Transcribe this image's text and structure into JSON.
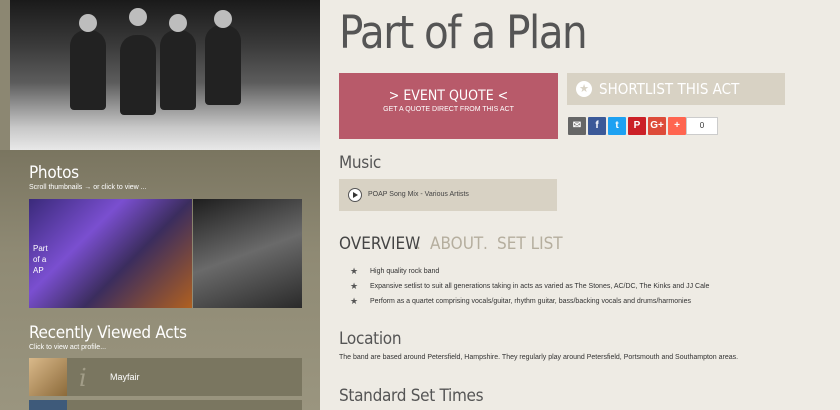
{
  "sidebar": {
    "photos_title": "Photos",
    "photos_subtitle": "Scroll thumbnails → or click to view ...",
    "thumb1_text": "Part\nof a\nAP",
    "recent_title": "Recently Viewed Acts",
    "recent_subtitle": "Click to view act profile...",
    "recent_items": [
      {
        "name": "Mayfair"
      }
    ]
  },
  "main": {
    "title": "Part of a Plan",
    "quote_button": {
      "line1": "> EVENT QUOTE <",
      "line2": "GET A QUOTE DIRECT FROM THIS ACT"
    },
    "shortlist_label": "SHORTLIST THIS ACT",
    "share_count": "0",
    "music_heading": "Music",
    "player_track": "POAP Song Mix - Various Artists",
    "tabs": [
      {
        "label": "OVERVIEW",
        "active": true
      },
      {
        "label": "ABOUT",
        "active": false
      },
      {
        "label": "SET LIST",
        "active": false
      }
    ],
    "tab_separator": ".",
    "overview_points": [
      "High quality rock band",
      "Expansive setlist to suit all generations taking in acts as varied as The Stones, AC/DC, The Kinks and JJ Cale",
      "Perform as a quartet comprising vocals/guitar, rhythm guitar, bass/backing vocals and drums/harmonies"
    ],
    "location_heading": "Location",
    "location_text": "The band are based around Petersfield, Hampshire. They regularly play around Petersfield, Portsmouth and Southampton areas.",
    "set_times_heading": "Standard Set Times"
  },
  "share_icons": [
    {
      "name": "email-icon",
      "glyph": "✉",
      "color": "#666666"
    },
    {
      "name": "facebook-icon",
      "glyph": "f",
      "color": "#3b5998"
    },
    {
      "name": "twitter-icon",
      "glyph": "t",
      "color": "#1da1f2"
    },
    {
      "name": "pinterest-icon",
      "glyph": "P",
      "color": "#cb2027"
    },
    {
      "name": "google-plus-icon",
      "glyph": "G+",
      "color": "#dd4b39"
    },
    {
      "name": "more-share-icon",
      "glyph": "+",
      "color": "#ff6550"
    }
  ],
  "colors": {
    "accent": "#b85a6a",
    "background": "#eeebe4",
    "sidebar": "#8c8772",
    "panel": "#d8d2c4",
    "tab_active": "#444444",
    "tab_inactive": "#b5ae9e"
  }
}
